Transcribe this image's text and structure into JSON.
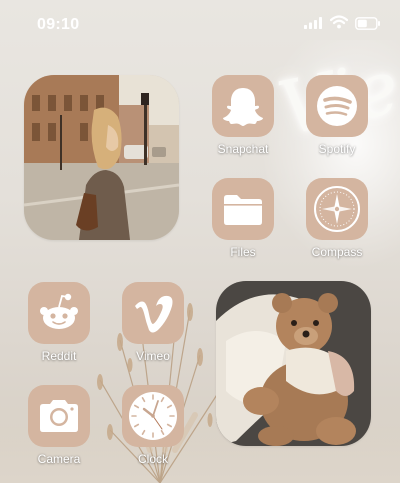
{
  "status_bar": {
    "time": "09:10",
    "icons": [
      "cellular-signal-icon",
      "wifi-icon",
      "battery-icon"
    ]
  },
  "widgets": [
    {
      "name": "photo-widget-street",
      "description": ""
    },
    {
      "name": "photo-widget-teddy",
      "description": ""
    }
  ],
  "wallpaper": {
    "neon_text": "Vie"
  },
  "apps": [
    {
      "label": "Snapchat",
      "icon": "snapchat-ghost-icon"
    },
    {
      "label": "Spotify",
      "icon": "spotify-icon"
    },
    {
      "label": "Files",
      "icon": "folder-icon"
    },
    {
      "label": "Compass",
      "icon": "compass-icon"
    },
    {
      "label": "Reddit",
      "icon": "reddit-icon"
    },
    {
      "label": "Vimeo",
      "icon": "vimeo-icon"
    },
    {
      "label": "Camera",
      "icon": "camera-icon"
    },
    {
      "label": "Clock",
      "icon": "clock-icon"
    }
  ],
  "colors": {
    "icon_tile": "#d4b5a0",
    "icon_glyph": "#ffffff",
    "label_text": "#ffffff"
  }
}
